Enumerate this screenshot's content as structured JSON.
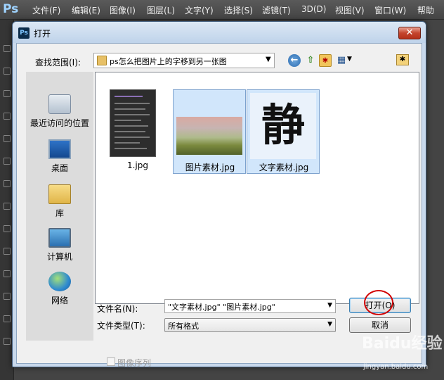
{
  "app": {
    "logo": "Ps",
    "menu": [
      "文件(F)",
      "编辑(E)",
      "图像(I)",
      "图层(L)",
      "文字(Y)",
      "选择(S)",
      "滤镜(T)",
      "3D(D)",
      "视图(V)",
      "窗口(W)",
      "帮助"
    ]
  },
  "dialog": {
    "title": "打开",
    "close_label": "✕",
    "look_in_label": "查找范围(I):",
    "look_in_value": "ps怎么把图片上的字移到另一张图",
    "places": [
      {
        "label": "最近访问的位置",
        "icon": "recent-places-icon"
      },
      {
        "label": "桌面",
        "icon": "desktop-icon"
      },
      {
        "label": "库",
        "icon": "library-icon"
      },
      {
        "label": "计算机",
        "icon": "computer-icon"
      },
      {
        "label": "网络",
        "icon": "network-icon"
      }
    ],
    "files": [
      {
        "name": "1.jpg",
        "selected": false
      },
      {
        "name": "图片素材.jpg",
        "selected": true
      },
      {
        "name": "文字素材.jpg",
        "selected": true,
        "thumb_text": "静"
      }
    ],
    "filename_label": "文件名(N):",
    "filename_value": "\"文字素材.jpg\" \"图片素材.jpg\"",
    "filetype_label": "文件类型(T):",
    "filetype_value": "所有格式",
    "open_button": "打开(O)",
    "cancel_button": "取消",
    "image_sequence_label": "图像序列",
    "image_sequence_checked": false
  },
  "watermark": {
    "logo": "Baidu经验",
    "url": "jingyan.baidu.com"
  }
}
